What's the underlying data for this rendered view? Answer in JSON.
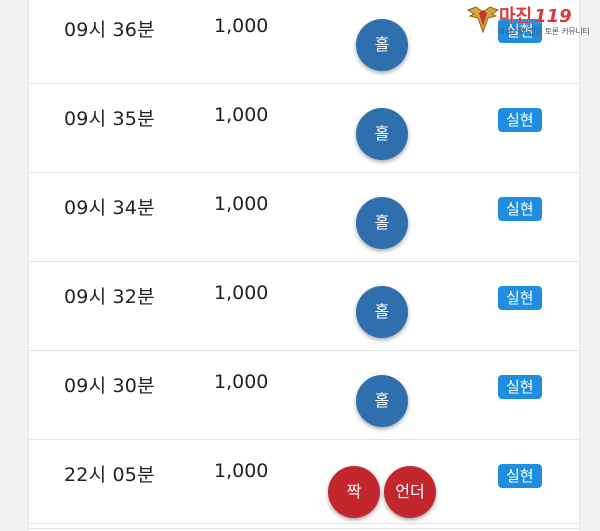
{
  "watermark": {
    "title": "마진",
    "number": "119",
    "subtitle": "마진거래 전문 토론 커뮤니티"
  },
  "rows": [
    {
      "time": "09시 36분",
      "amount": "1,000",
      "bets": [
        {
          "label": "홀",
          "color": "blue"
        }
      ],
      "status": "실현"
    },
    {
      "time": "09시 35분",
      "amount": "1,000",
      "bets": [
        {
          "label": "홀",
          "color": "blue"
        }
      ],
      "status": "실현"
    },
    {
      "time": "09시 34분",
      "amount": "1,000",
      "bets": [
        {
          "label": "홀",
          "color": "blue"
        }
      ],
      "status": "실현"
    },
    {
      "time": "09시 32분",
      "amount": "1,000",
      "bets": [
        {
          "label": "홀",
          "color": "blue"
        }
      ],
      "status": "실현"
    },
    {
      "time": "09시 30분",
      "amount": "1,000",
      "bets": [
        {
          "label": "홀",
          "color": "blue"
        }
      ],
      "status": "실현"
    },
    {
      "time": "22시 05분",
      "amount": "1,000",
      "bets": [
        {
          "label": "짝",
          "color": "red"
        },
        {
          "label": "언더",
          "color": "red"
        }
      ],
      "status": "실현"
    }
  ],
  "colors": {
    "odd_chip": "#2f6fae",
    "even_chip": "#c1272d",
    "status_badge": "#1f8ee0"
  }
}
